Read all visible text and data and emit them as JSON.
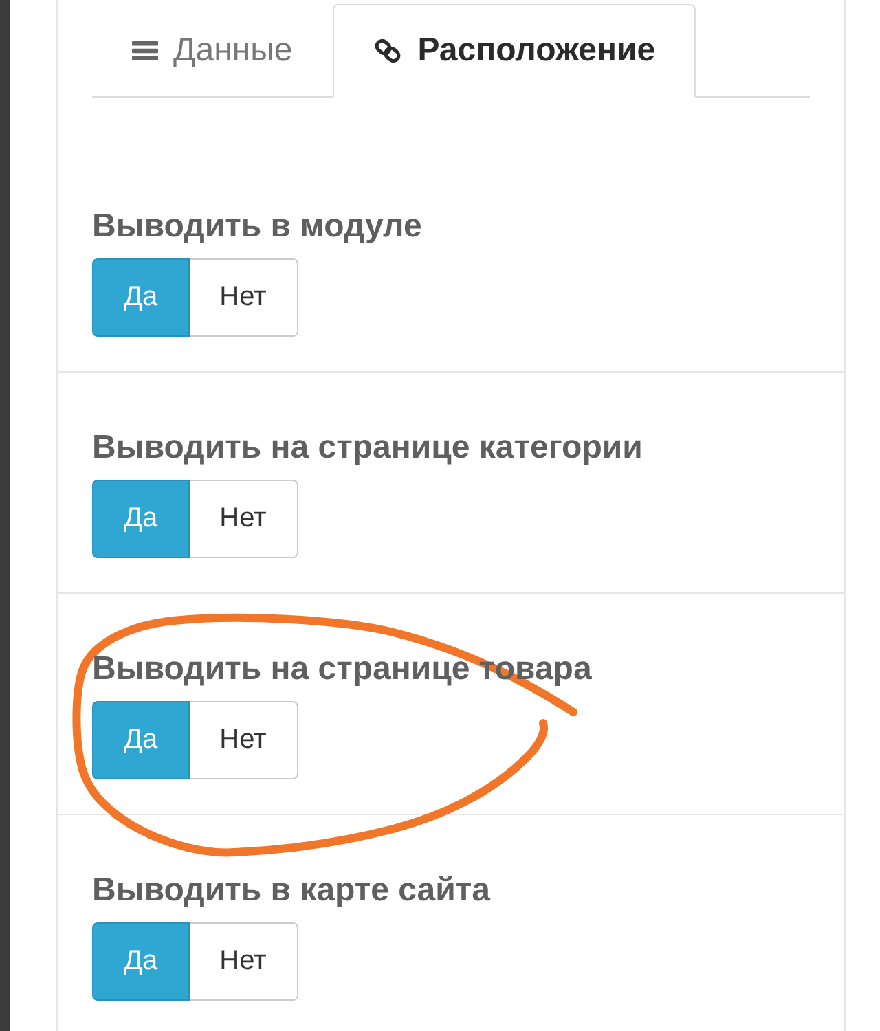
{
  "tabs": [
    {
      "label": "Данные",
      "selected": false
    },
    {
      "label": "Расположение",
      "selected": true
    }
  ],
  "settings": [
    {
      "label": "Выводить в модуле",
      "circled": false,
      "options": [
        {
          "label": "Да",
          "selected": true
        },
        {
          "label": "Нет",
          "selected": false
        }
      ]
    },
    {
      "label": "Выводить на странице категории",
      "circled": false,
      "options": [
        {
          "label": "Да",
          "selected": true
        },
        {
          "label": "Нет",
          "selected": false
        }
      ]
    },
    {
      "label": "Выводить на странице товара",
      "circled": true,
      "options": [
        {
          "label": "Да",
          "selected": true
        },
        {
          "label": "Нет",
          "selected": false
        }
      ]
    },
    {
      "label": "Выводить в карте сайта",
      "circled": false,
      "options": [
        {
          "label": "Да",
          "selected": true
        },
        {
          "label": "Нет",
          "selected": false
        }
      ]
    }
  ]
}
